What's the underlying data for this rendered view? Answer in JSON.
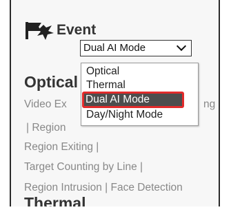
{
  "event": {
    "title": "Event",
    "icon": "ai-event-icon"
  },
  "mode_select": {
    "value": "Dual AI Mode"
  },
  "dropdown": {
    "options": [
      "Optical",
      "Thermal",
      "Dual AI Mode",
      "Day/Night Mode"
    ],
    "selected": "Dual AI Mode"
  },
  "optical": {
    "title": "Optical",
    "capabilities_line1_left": "Video Ex",
    "capabilities_line1_right": "ng",
    "capabilities_line2_left": "| Region",
    "capabilities_line3": "Region Exiting |",
    "capabilities_line4": "Target Counting by Line |",
    "capabilities_line5": "Region Intrusion | Face Detection"
  },
  "next_section_partial": "Thermal",
  "colors": {
    "highlight": "#e22b2b",
    "selected_bg": "#4d4d4d"
  }
}
